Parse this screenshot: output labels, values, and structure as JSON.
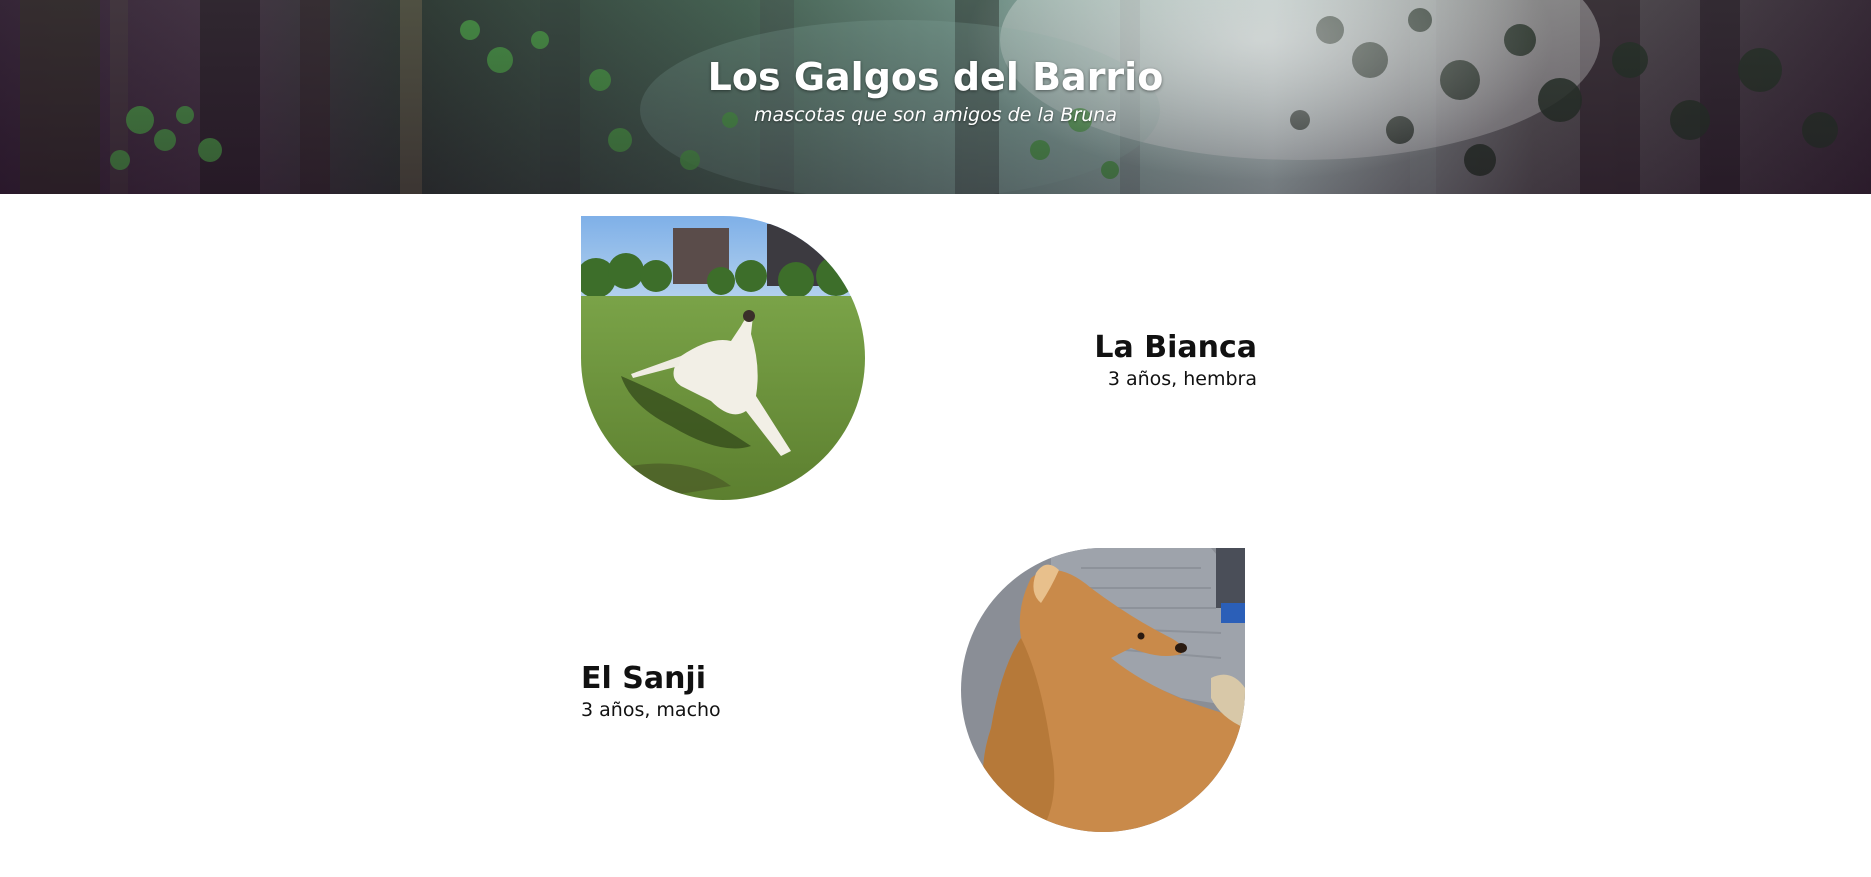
{
  "header": {
    "title": "Los Galgos del Barrio",
    "subtitle": "mascotas que son amigos de la Bruna"
  },
  "pets": [
    {
      "name": "La Bianca",
      "info": "3 años, hembra"
    },
    {
      "name": "El Sanji",
      "info": "3 años, macho"
    }
  ],
  "colors": {
    "text": "#111111",
    "header_text": "#ffffff",
    "background": "#ffffff"
  }
}
